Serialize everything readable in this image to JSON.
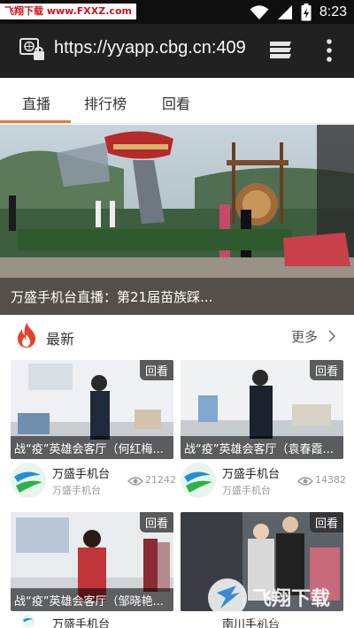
{
  "status_bar": {
    "watermark": "飞翔下载 www.FXXZ.com",
    "time": "8:23",
    "icons": [
      "wifi-icon",
      "signal-icon",
      "battery-icon"
    ]
  },
  "url_bar": {
    "url": "https://yyapp.cbg.cn:409",
    "icons": [
      "site-info-icon",
      "tabs-icon",
      "more-vert-icon"
    ]
  },
  "tabs": [
    {
      "label": "直播",
      "active": true
    },
    {
      "label": "排行榜",
      "active": false
    },
    {
      "label": "回看",
      "active": false
    }
  ],
  "hero": {
    "caption": "万盛手机台直播：第21届苗族踩..."
  },
  "section": {
    "title": "最新",
    "more": "更多"
  },
  "cards": [
    {
      "badge": "回看",
      "title": "战“疫”英雄会客厅（何红梅...",
      "author": "万盛手机台",
      "sub": "万盛手机台",
      "views": "21242"
    },
    {
      "badge": "回看",
      "title": "战“疫”英雄会客厅（袁春霞...",
      "author": "万盛手机台",
      "sub": "万盛手机台",
      "views": "14382"
    },
    {
      "badge": "回看",
      "title": "战“疫”英雄会客厅（邹晓艳...",
      "author": "万盛手机台",
      "sub": "",
      "views": ""
    },
    {
      "badge": "回看",
      "title": "",
      "author": "南川手机台",
      "sub": "",
      "views": ""
    }
  ],
  "watermark_bottom": {
    "brand": "飞翔下载",
    "url": "WWW.FXXZ.COM"
  },
  "colors": {
    "accent": "#e87a3a",
    "fire": "#e8402a",
    "avatar_green": "#2db24a",
    "avatar_blue": "#1f8fd6",
    "status_bar": "#0f0f0f",
    "url_bar": "#212121"
  }
}
